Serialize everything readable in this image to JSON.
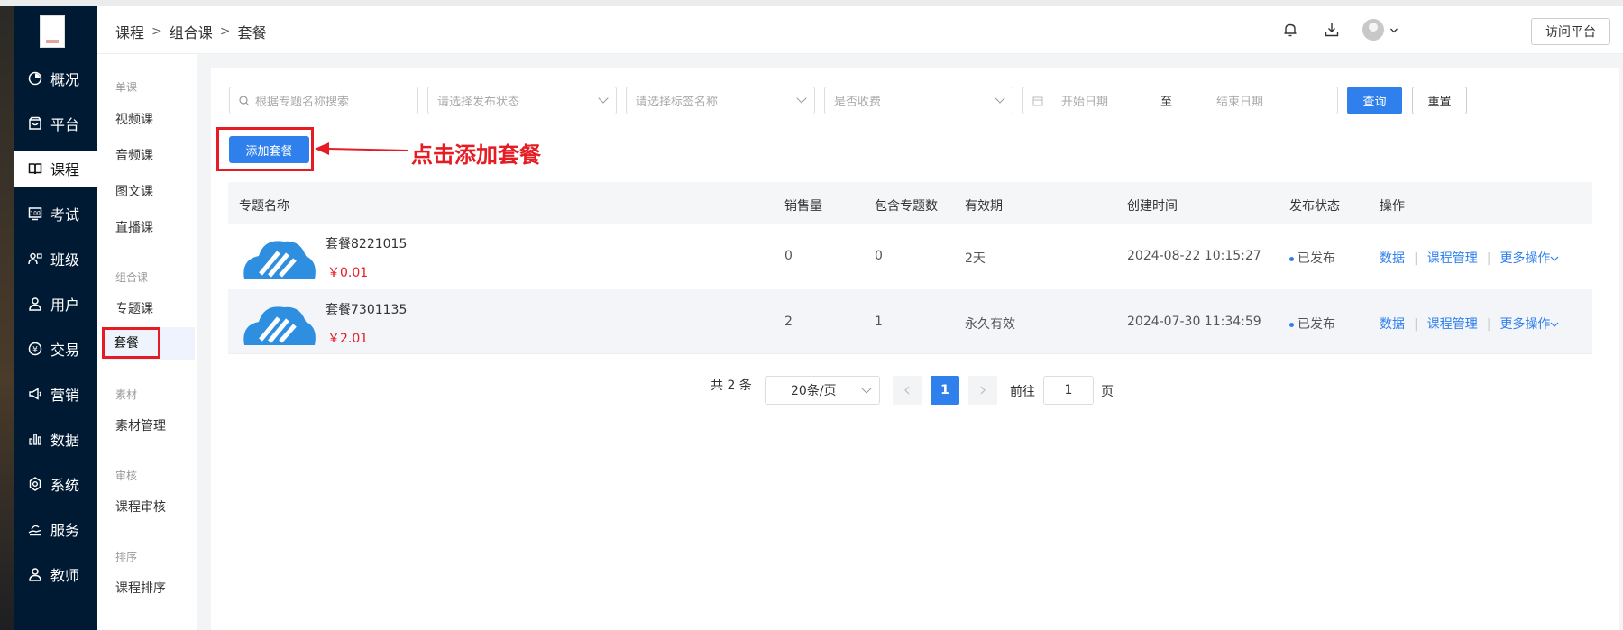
{
  "breadcrumb": {
    "items": [
      "课程",
      "组合课",
      "套餐"
    ],
    "separator": ">"
  },
  "header": {
    "visit_label": "访问平台"
  },
  "left_nav": {
    "items": [
      {
        "label": "概况",
        "icon": "dashboard-icon"
      },
      {
        "label": "平台",
        "icon": "store-icon"
      },
      {
        "label": "课程",
        "icon": "book-icon",
        "active": true
      },
      {
        "label": "考试",
        "icon": "exam-icon"
      },
      {
        "label": "班级",
        "icon": "class-icon"
      },
      {
        "label": "用户",
        "icon": "user-icon"
      },
      {
        "label": "交易",
        "icon": "trade-icon"
      },
      {
        "label": "营销",
        "icon": "megaphone-icon"
      },
      {
        "label": "数据",
        "icon": "bar-chart-icon"
      },
      {
        "label": "系统",
        "icon": "gear-icon"
      },
      {
        "label": "服务",
        "icon": "service-icon"
      },
      {
        "label": "教师",
        "icon": "teacher-icon"
      }
    ]
  },
  "sub_nav": {
    "groups": [
      {
        "title": "单课",
        "items": [
          "视频课",
          "音频课",
          "图文课",
          "直播课"
        ]
      },
      {
        "title": "组合课",
        "items": [
          "专题课",
          "套餐"
        ]
      },
      {
        "title": "素材",
        "items": [
          "素材管理"
        ]
      },
      {
        "title": "审核",
        "items": [
          "课程审核"
        ]
      },
      {
        "title": "排序",
        "items": [
          "课程排序"
        ]
      }
    ],
    "active": "套餐"
  },
  "filters": {
    "search_placeholder": "根据专题名称搜索",
    "status_placeholder": "请选择发布状态",
    "tag_placeholder": "请选择标签名称",
    "fee_placeholder": "是否收费",
    "start_placeholder": "开始日期",
    "range_sep": "至",
    "end_placeholder": "结束日期",
    "query_label": "查询",
    "reset_label": "重置"
  },
  "add_button_label": "添加套餐",
  "annotation_text": "点击添加套餐",
  "table": {
    "headers": [
      "专题名称",
      "销售量",
      "包含专题数",
      "有效期",
      "创建时间",
      "发布状态",
      "操作"
    ],
    "rows": [
      {
        "name": "套餐8221015",
        "price": "￥0.01",
        "sales": "0",
        "topics": "0",
        "validity": "2天",
        "created": "2024-08-22 10:15:27",
        "status": "已发布"
      },
      {
        "name": "套餐7301135",
        "price": "￥2.01",
        "sales": "2",
        "topics": "1",
        "validity": "永久有效",
        "created": "2024-07-30 11:34:59",
        "status": "已发布"
      }
    ],
    "actions": [
      "数据",
      "课程管理",
      "更多操作"
    ]
  },
  "pagination": {
    "total_text": "共 2 条",
    "page_size": "20条/页",
    "current_page": "1",
    "goto_prefix": "前往",
    "goto_value": "1",
    "goto_suffix": "页"
  },
  "colors": {
    "primary": "#2f80ed",
    "annotation_red": "#e51c23",
    "nav_bg": "#001a33"
  }
}
